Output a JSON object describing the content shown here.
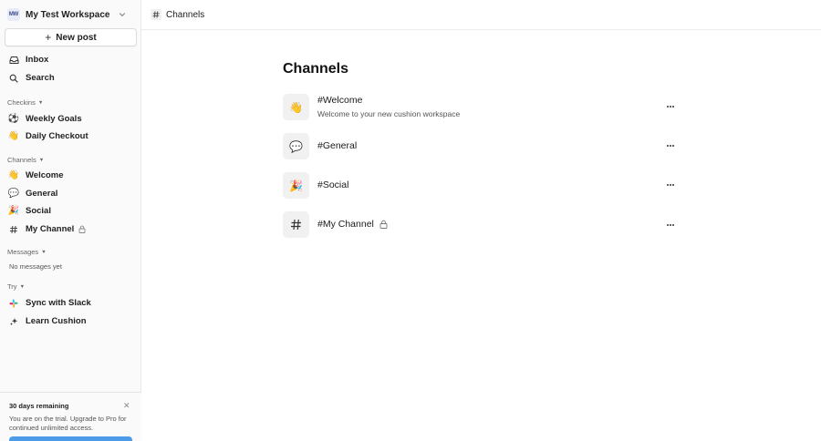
{
  "workspace": {
    "avatar_initials": "MW",
    "name": "My Test Workspace",
    "chevron_icon": "chevron-down-icon"
  },
  "sidebar": {
    "new_post_label": "New post",
    "inbox_label": "Inbox",
    "search_label": "Search",
    "checkins": {
      "header": "Checkins",
      "items": [
        {
          "label": "Weekly Goals",
          "icon": "soccer-ball-icon",
          "glyph": "⚽"
        },
        {
          "label": "Daily Checkout",
          "icon": "waving-hand-icon",
          "glyph": "👋"
        }
      ]
    },
    "channels": {
      "header": "Channels",
      "items": [
        {
          "label": "Welcome",
          "icon": "waving-hand-icon",
          "glyph": "👋"
        },
        {
          "label": "General",
          "icon": "speech-bubble-icon",
          "glyph": "💬"
        },
        {
          "label": "Social",
          "icon": "party-popper-icon",
          "glyph": "🎉"
        },
        {
          "label": "My Channel",
          "icon": "hash-icon",
          "private": true
        }
      ]
    },
    "messages": {
      "header": "Messages",
      "empty_text": "No messages yet"
    },
    "try": {
      "header": "Try",
      "items": [
        {
          "label": "Sync with Slack",
          "icon": "slack-icon"
        },
        {
          "label": "Learn Cushion",
          "icon": "sparkles-icon"
        }
      ]
    },
    "trial": {
      "title": "30 days remaining",
      "body": "You are on the trial. Upgrade to Pro for continued unlimited access.",
      "button_color": "#4c9be8"
    }
  },
  "header": {
    "title": "Channels",
    "icon": "hash-icon"
  },
  "main": {
    "title": "Channels",
    "channels": [
      {
        "name": "#Welcome",
        "description": "Welcome to your new cushion workspace",
        "icon": "waving-hand-icon",
        "glyph": "👋"
      },
      {
        "name": "#General",
        "description": "",
        "icon": "speech-bubble-icon",
        "glyph": "💬"
      },
      {
        "name": "#Social",
        "description": "",
        "icon": "party-popper-icon",
        "glyph": "🎉"
      },
      {
        "name": "#My Channel",
        "description": "",
        "icon": "hash-icon",
        "private": true
      }
    ]
  }
}
